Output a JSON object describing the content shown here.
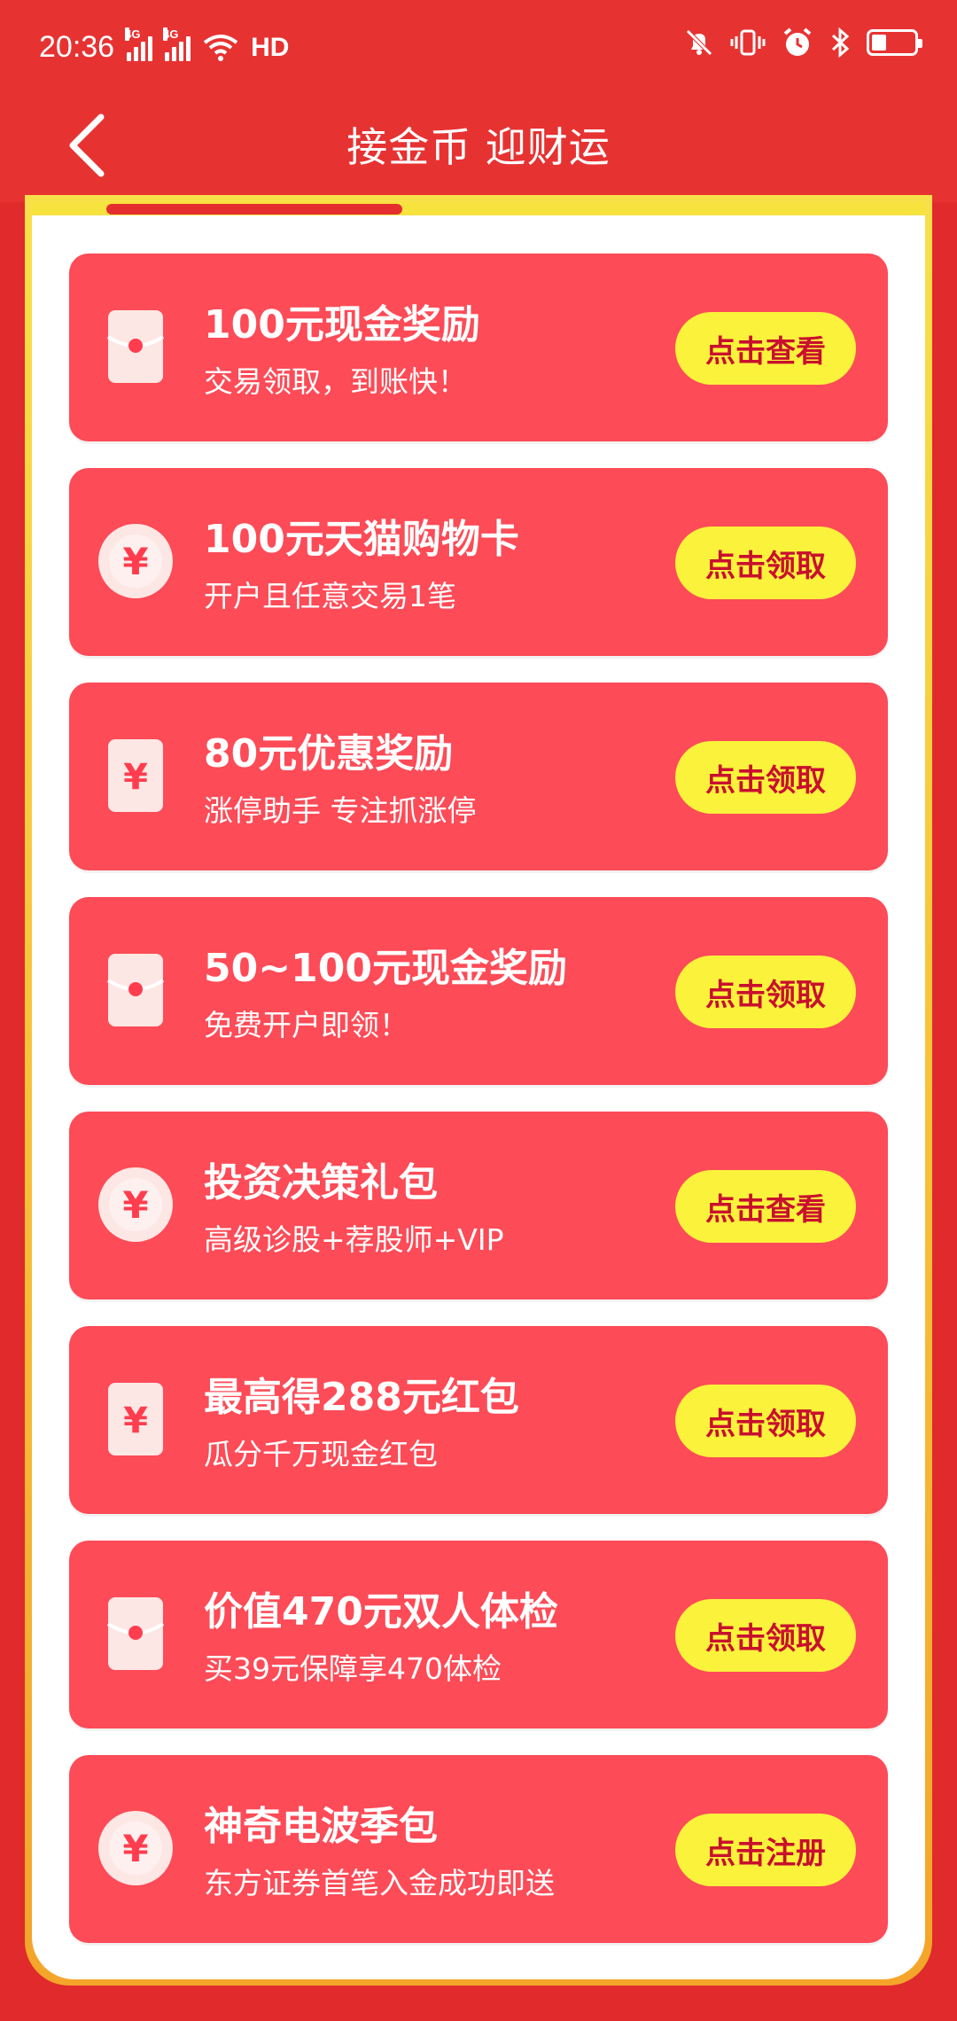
{
  "status": {
    "time": "20:36",
    "network1": "4G",
    "network2": "4G",
    "hd": "HD"
  },
  "nav": {
    "title": "接金币 迎财运"
  },
  "cards": [
    {
      "icon": "red-envelope-icon",
      "title": "100元现金奖励",
      "subtitle": "交易领取，到账快！",
      "button": "点击查看"
    },
    {
      "icon": "yuan-coin-icon",
      "title": "100元天猫购物卡",
      "subtitle": "开户且任意交易1笔",
      "button": "点击领取"
    },
    {
      "icon": "yuan-envelope-icon",
      "title": "80元优惠奖励",
      "subtitle": "涨停助手 专注抓涨停",
      "button": "点击领取"
    },
    {
      "icon": "red-envelope-icon",
      "title": "50~100元现金奖励",
      "subtitle": "免费开户即领！",
      "button": "点击领取"
    },
    {
      "icon": "yuan-coin-icon",
      "title": "投资决策礼包",
      "subtitle": "高级诊股+荐股师+VIP",
      "button": "点击查看"
    },
    {
      "icon": "yuan-envelope-icon",
      "title": "最高得288元红包",
      "subtitle": "瓜分千万现金红包",
      "button": "点击领取"
    },
    {
      "icon": "red-envelope-icon",
      "title": "价值470元双人体检",
      "subtitle": "买39元保障享470体检",
      "button": "点击领取"
    },
    {
      "icon": "yuan-coin-icon",
      "title": "神奇电波季包",
      "subtitle": "东方证券首笔入金成功即送",
      "button": "点击注册"
    }
  ]
}
